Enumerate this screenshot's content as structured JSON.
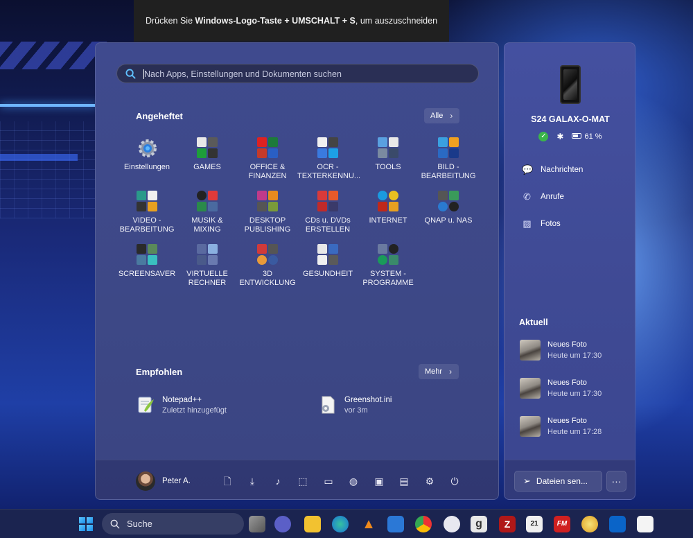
{
  "snip_hint": {
    "prefix": "Drücken Sie",
    "keys": "Windows-Logo-Taste + UMSCHALT + S",
    "suffix": ", um auszuschneiden"
  },
  "start_menu": {
    "search_placeholder": "Nach Apps, Einstellungen und Dokumenten suchen",
    "pinned": {
      "title": "Angeheftet",
      "all_button": "Alle",
      "items": [
        {
          "label": "Einstellungen",
          "icon": "gear-icon"
        },
        {
          "label": "GAMES",
          "icon": "folder-games-icon"
        },
        {
          "label": "OFFICE &\nFINANZEN",
          "icon": "folder-office-icon"
        },
        {
          "label": "OCR -\nTEXTERKENNU...",
          "icon": "folder-ocr-icon"
        },
        {
          "label": "TOOLS",
          "icon": "folder-tools-icon"
        },
        {
          "label": "BILD -\nBEARBEITUNG",
          "icon": "folder-image-icon"
        },
        {
          "label": "VIDEO -\nBEARBEITUNG",
          "icon": "folder-video-icon"
        },
        {
          "label": "MUSIK &\nMIXING",
          "icon": "folder-music-icon"
        },
        {
          "label": "DESKTOP\nPUBLISHING",
          "icon": "folder-publishing-icon"
        },
        {
          "label": "CDs u. DVDs\nERSTELLEN",
          "icon": "folder-cd-icon"
        },
        {
          "label": "INTERNET",
          "icon": "folder-internet-icon"
        },
        {
          "label": "QNAP u. NAS",
          "icon": "folder-nas-icon"
        },
        {
          "label": "SCREENSAVER",
          "icon": "folder-screensaver-icon"
        },
        {
          "label": "VIRTUELLE\nRECHNER",
          "icon": "folder-vm-icon"
        },
        {
          "label": "3D\nENTWICKLUNG",
          "icon": "folder-3d-icon"
        },
        {
          "label": "GESUNDHEIT",
          "icon": "folder-health-icon"
        },
        {
          "label": "SYSTEM -\nPROGRAMME",
          "icon": "folder-system-icon"
        }
      ]
    },
    "recommended": {
      "title": "Empfohlen",
      "more_button": "Mehr",
      "items": [
        {
          "name": "Notepad++",
          "detail": "Zuletzt hinzugefügt",
          "icon": "notepadpp-icon"
        },
        {
          "name": "Greenshot.ini",
          "detail": "vor 3m",
          "icon": "settings-file-icon"
        }
      ]
    },
    "footer": {
      "user_name": "Peter A.",
      "icons": [
        "document-icon",
        "download-icon",
        "music-icon",
        "pictures-icon",
        "video-icon",
        "network-icon",
        "user-folder-icon",
        "file-explorer-icon",
        "settings-icon",
        "power-icon"
      ]
    }
  },
  "phone_link": {
    "device_name": "S24 GALAX-O-MAT",
    "battery": "61 %",
    "menu": [
      {
        "label": "Nachrichten",
        "icon": "messages-icon"
      },
      {
        "label": "Anrufe",
        "icon": "calls-icon"
      },
      {
        "label": "Fotos",
        "icon": "photos-icon"
      }
    ],
    "recent_title": "Aktuell",
    "recent": [
      {
        "title": "Neues Foto",
        "time": "Heute um 17:30"
      },
      {
        "title": "Neues Foto",
        "time": "Heute um 17:30"
      },
      {
        "title": "Neues Foto",
        "time": "Heute um 17:28"
      }
    ],
    "send_button": "Dateien sen...",
    "more_button": "···"
  },
  "taskbar": {
    "search_label": "Suche",
    "apps": [
      "task-view-icon",
      "teams-icon",
      "file-explorer-icon",
      "edge-icon",
      "vlc-icon",
      "store-icon",
      "chrome-icon",
      "tunein-icon",
      "g-app-icon",
      "filezilla-icon",
      "calendar-app-icon",
      "fm-app-icon",
      "paint-tool-icon",
      "outlook-icon",
      "notepad-app-icon"
    ],
    "g_app_letter": "g",
    "fm_letter": "FM",
    "calendar_number": "21"
  },
  "colors": {
    "start_bg": "#3f4a8e",
    "phone_bg": "#4450a0",
    "taskbar_bg": "#1b2450",
    "accent": "#3bb54a"
  }
}
